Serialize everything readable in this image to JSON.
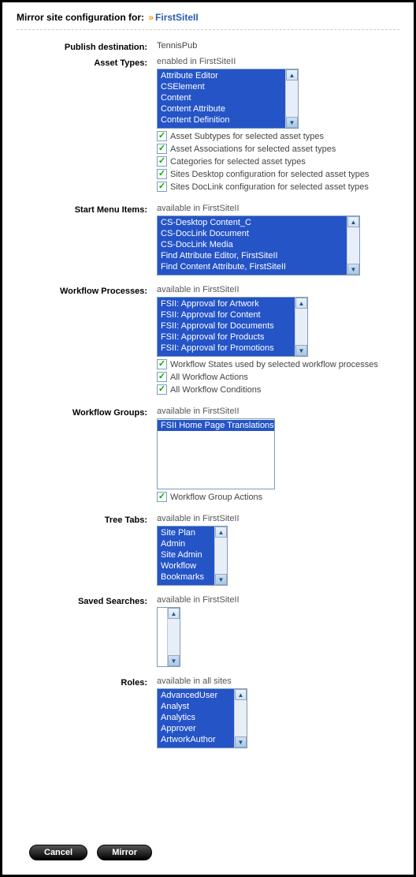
{
  "header": {
    "title_prefix": "Mirror site configuration for:",
    "site_name": "FirstSiteII"
  },
  "publish_destination": {
    "label": "Publish destination:",
    "value": "TennisPub"
  },
  "asset_types": {
    "label": "Asset Types:",
    "hint": "enabled in FirstSiteII",
    "options": [
      "Attribute Editor",
      "CSElement",
      "Content",
      "Content Attribute",
      "Content Definition"
    ],
    "checkboxes": [
      "Asset Subtypes for selected asset types",
      "Asset Associations for selected asset types",
      "Categories for selected asset types",
      "Sites Desktop configuration for selected asset types",
      "Sites DocLink configuration for selected asset types"
    ]
  },
  "start_menu": {
    "label": "Start Menu Items:",
    "hint": "available in FirstSiteII",
    "options": [
      "CS-Desktop Content_C",
      "CS-DocLink Document",
      "CS-DocLink Media",
      "Find Attribute Editor, FirstSiteII",
      "Find Content Attribute, FirstSiteII"
    ]
  },
  "workflow_processes": {
    "label": "Workflow Processes:",
    "hint": "available in FirstSiteII",
    "options": [
      "FSII: Approval for Artwork",
      "FSII: Approval for Content",
      "FSII: Approval for Documents",
      "FSII: Approval for Products",
      "FSII: Approval for Promotions"
    ],
    "checkboxes": [
      "Workflow States used by selected workflow processes",
      "All Workflow Actions",
      "All Workflow Conditions"
    ]
  },
  "workflow_groups": {
    "label": "Workflow Groups:",
    "hint": "available in FirstSiteII",
    "options": [
      "FSII Home Page Translations"
    ],
    "checkboxes": [
      "Workflow Group Actions"
    ]
  },
  "tree_tabs": {
    "label": "Tree Tabs:",
    "hint": "available in FirstSiteII",
    "options": [
      "Site Plan",
      "Admin",
      "Site Admin",
      "Workflow",
      "Bookmarks"
    ]
  },
  "saved_searches": {
    "label": "Saved Searches:",
    "hint": "available in FirstSiteII",
    "options": []
  },
  "roles": {
    "label": "Roles:",
    "hint": "available in all sites",
    "options": [
      "AdvancedUser",
      "Analyst",
      "Analytics",
      "Approver",
      "ArtworkAuthor"
    ]
  },
  "buttons": {
    "cancel": "Cancel",
    "mirror": "Mirror"
  }
}
